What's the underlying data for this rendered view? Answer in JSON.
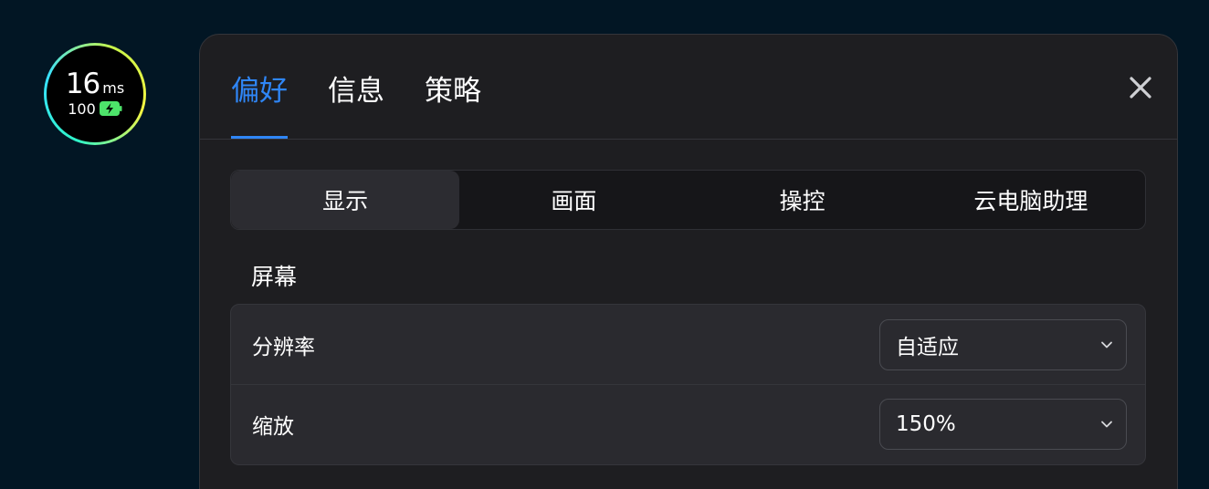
{
  "latency": {
    "value": "16",
    "unit": "ms",
    "battery": "100",
    "battery_icon": "battery-charging-icon"
  },
  "tabs": [
    {
      "label": "偏好",
      "active": true
    },
    {
      "label": "信息",
      "active": false
    },
    {
      "label": "策略",
      "active": false
    }
  ],
  "close_icon": "close-icon",
  "subtabs": [
    {
      "label": "显示",
      "active": true
    },
    {
      "label": "画面",
      "active": false
    },
    {
      "label": "操控",
      "active": false
    },
    {
      "label": "云电脑助理",
      "active": false
    }
  ],
  "section": {
    "title": "屏幕"
  },
  "settings": [
    {
      "label": "分辨率",
      "value": "自适应"
    },
    {
      "label": "缩放",
      "value": "150%"
    }
  ],
  "colors": {
    "background": "#021624",
    "panel": "#1e1e21",
    "accent": "#2f86f6",
    "battery": "#4de36a"
  }
}
